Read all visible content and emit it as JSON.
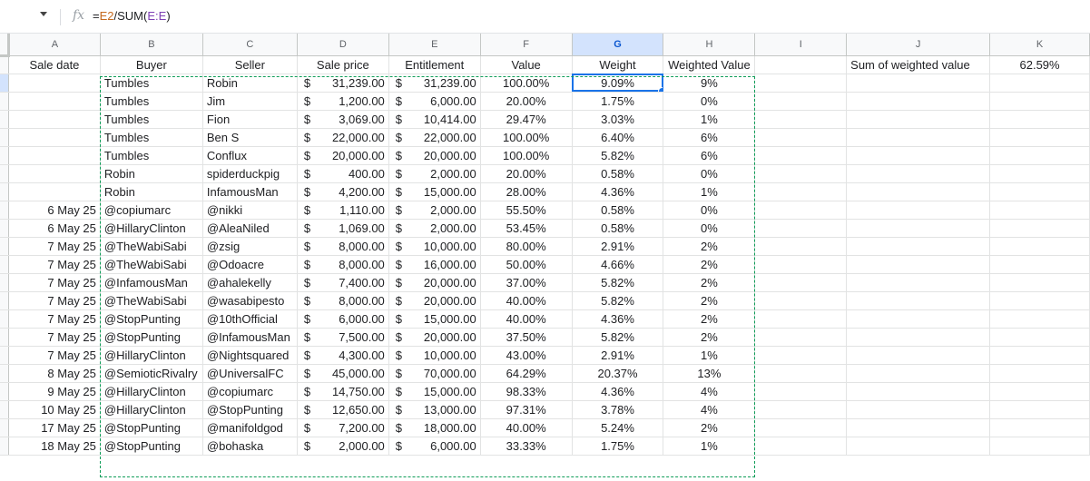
{
  "formula_bar": {
    "fx_label": "fx",
    "prefix": "=",
    "ref1": "E2",
    "mid": "/SUM(",
    "ref2": "E:E",
    "suffix": ")"
  },
  "columns": [
    "A",
    "B",
    "C",
    "D",
    "E",
    "F",
    "G",
    "H",
    "I",
    "J",
    "K"
  ],
  "header": {
    "sale_date": "Sale date",
    "buyer": "Buyer",
    "seller": "Seller",
    "sale_price": "Sale price",
    "entitlement": "Entitlement",
    "value": "Value",
    "weight": "Weight",
    "weighted_value": "Weighted Value",
    "sum_label": "Sum of weighted value",
    "sum_value": "62.59%"
  },
  "currency_symbol": "$",
  "rows": [
    {
      "date": "",
      "buyer": "Tumbles",
      "seller": "Robin",
      "price": "31,239.00",
      "ent": "31,239.00",
      "value": "100.00%",
      "weight": "9.09%",
      "wv": "9%"
    },
    {
      "date": "",
      "buyer": "Tumbles",
      "seller": "Jim",
      "price": "1,200.00",
      "ent": "6,000.00",
      "value": "20.00%",
      "weight": "1.75%",
      "wv": "0%"
    },
    {
      "date": "",
      "buyer": "Tumbles",
      "seller": "Fion",
      "price": "3,069.00",
      "ent": "10,414.00",
      "value": "29.47%",
      "weight": "3.03%",
      "wv": "1%"
    },
    {
      "date": "",
      "buyer": "Tumbles",
      "seller": "Ben S",
      "price": "22,000.00",
      "ent": "22,000.00",
      "value": "100.00%",
      "weight": "6.40%",
      "wv": "6%"
    },
    {
      "date": "",
      "buyer": "Tumbles",
      "seller": "Conflux",
      "price": "20,000.00",
      "ent": "20,000.00",
      "value": "100.00%",
      "weight": "5.82%",
      "wv": "6%"
    },
    {
      "date": "",
      "buyer": "Robin",
      "seller": "spiderduckpig",
      "price": "400.00",
      "ent": "2,000.00",
      "value": "20.00%",
      "weight": "0.58%",
      "wv": "0%"
    },
    {
      "date": "",
      "buyer": "Robin",
      "seller": "InfamousMan",
      "price": "4,200.00",
      "ent": "15,000.00",
      "value": "28.00%",
      "weight": "4.36%",
      "wv": "1%"
    },
    {
      "date": "6 May 25",
      "buyer": "@copiumarc",
      "seller": "@nikki",
      "price": "1,110.00",
      "ent": "2,000.00",
      "value": "55.50%",
      "weight": "0.58%",
      "wv": "0%"
    },
    {
      "date": "6 May 25",
      "buyer": "@HillaryClinton",
      "seller": "@AleaNiled",
      "price": "1,069.00",
      "ent": "2,000.00",
      "value": "53.45%",
      "weight": "0.58%",
      "wv": "0%"
    },
    {
      "date": "7 May 25",
      "buyer": "@TheWabiSabi",
      "seller": "@zsig",
      "price": "8,000.00",
      "ent": "10,000.00",
      "value": "80.00%",
      "weight": "2.91%",
      "wv": "2%"
    },
    {
      "date": "7 May 25",
      "buyer": "@TheWabiSabi",
      "seller": "@Odoacre",
      "price": "8,000.00",
      "ent": "16,000.00",
      "value": "50.00%",
      "weight": "4.66%",
      "wv": "2%"
    },
    {
      "date": "7 May 25",
      "buyer": "@InfamousMan",
      "seller": "@ahalekelly",
      "price": "7,400.00",
      "ent": "20,000.00",
      "value": "37.00%",
      "weight": "5.82%",
      "wv": "2%"
    },
    {
      "date": "7 May 25",
      "buyer": "@TheWabiSabi",
      "seller": "@wasabipesto",
      "price": "8,000.00",
      "ent": "20,000.00",
      "value": "40.00%",
      "weight": "5.82%",
      "wv": "2%"
    },
    {
      "date": "7 May 25",
      "buyer": "@StopPunting",
      "seller": "@10thOfficial",
      "price": "6,000.00",
      "ent": "15,000.00",
      "value": "40.00%",
      "weight": "4.36%",
      "wv": "2%"
    },
    {
      "date": "7 May 25",
      "buyer": "@StopPunting",
      "seller": "@InfamousMan",
      "price": "7,500.00",
      "ent": "20,000.00",
      "value": "37.50%",
      "weight": "5.82%",
      "wv": "2%"
    },
    {
      "date": "7 May 25",
      "buyer": "@HillaryClinton",
      "seller": "@Nightsquared",
      "price": "4,300.00",
      "ent": "10,000.00",
      "value": "43.00%",
      "weight": "2.91%",
      "wv": "1%"
    },
    {
      "date": "8 May 25",
      "buyer": "@SemioticRivalry",
      "seller": "@UniversalFC",
      "price": "45,000.00",
      "ent": "70,000.00",
      "value": "64.29%",
      "weight": "20.37%",
      "wv": "13%"
    },
    {
      "date": "9 May 25",
      "buyer": "@HillaryClinton",
      "seller": "@copiumarc",
      "price": "14,750.00",
      "ent": "15,000.00",
      "value": "98.33%",
      "weight": "4.36%",
      "wv": "4%"
    },
    {
      "date": "10 May 25",
      "buyer": "@HillaryClinton",
      "seller": "@StopPunting",
      "price": "12,650.00",
      "ent": "13,000.00",
      "value": "97.31%",
      "weight": "3.78%",
      "wv": "4%"
    },
    {
      "date": "17 May 25",
      "buyer": "@StopPunting",
      "seller": "@manifoldgod",
      "price": "7,200.00",
      "ent": "18,000.00",
      "value": "40.00%",
      "weight": "5.24%",
      "wv": "2%"
    },
    {
      "date": "18 May 25",
      "buyer": "@StopPunting",
      "seller": "@bohaska",
      "price": "2,000.00",
      "ent": "6,000.00",
      "value": "33.33%",
      "weight": "1.75%",
      "wv": "1%"
    }
  ]
}
